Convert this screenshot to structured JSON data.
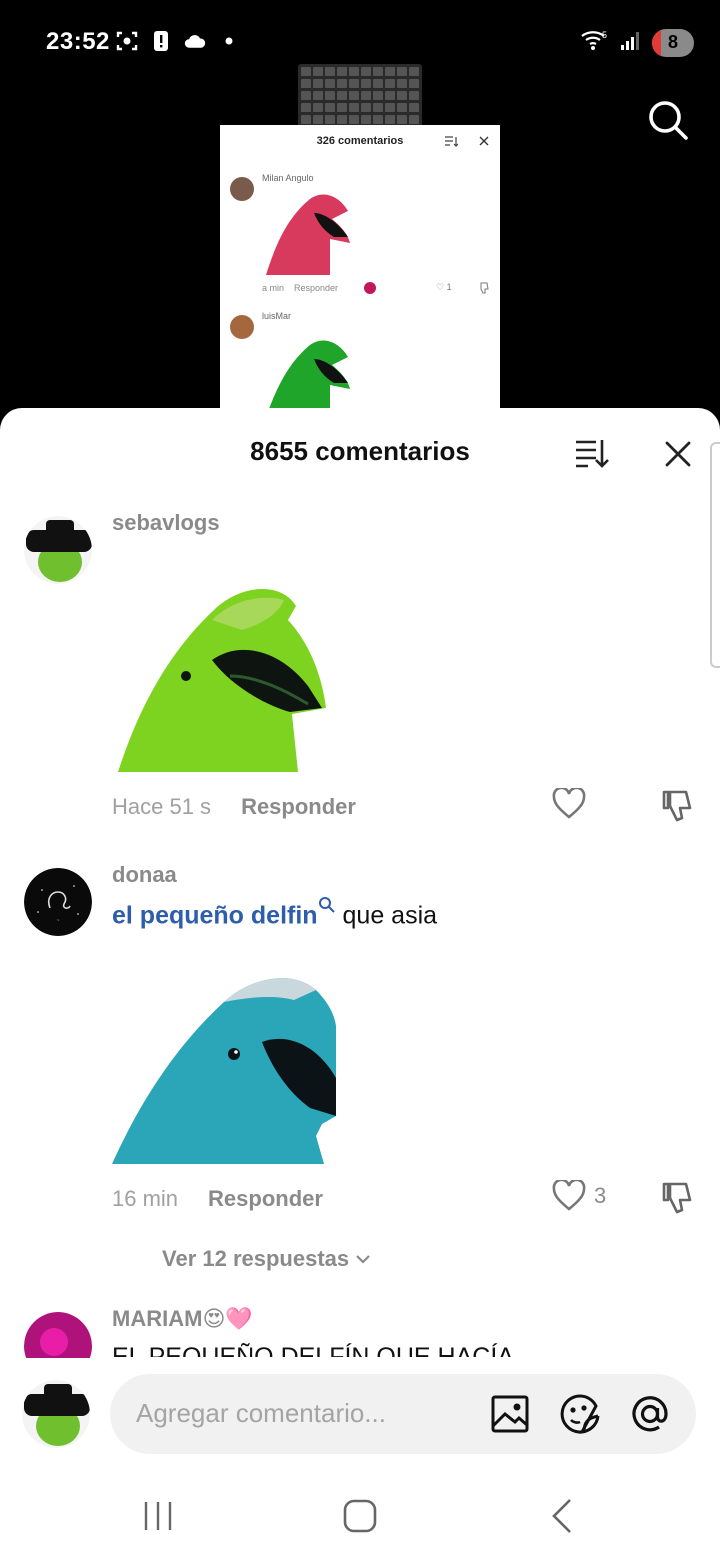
{
  "status_bar": {
    "time": "23:52",
    "battery_level": "8",
    "signal_label": "5"
  },
  "mini_preview": {
    "title": "326 comentarios",
    "comments": [
      {
        "user": "Milan Angulo",
        "time": "a min",
        "reply": "Responder",
        "likes": "1"
      },
      {
        "user": "luisMar"
      }
    ]
  },
  "sheet": {
    "title": "8655 comentarios"
  },
  "comments": [
    {
      "username": "sebavlogs",
      "time": "Hace 51 s",
      "reply_label": "Responder",
      "likes": ""
    },
    {
      "username": "donaa",
      "hashtag": "el pequeño delfin",
      "text": " que asia",
      "time": "16 min",
      "reply_label": "Responder",
      "likes": "3",
      "view_replies": "Ver 12 respuestas"
    },
    {
      "username": "MARIAM",
      "username_emoji": "😍🩷",
      "text": "EL PEQUEÑO DELFÍN QUE HACÍA"
    }
  ],
  "composer": {
    "placeholder": "Agregar comentario..."
  },
  "colors": {
    "hashtag": "#2e5dab",
    "muted": "#8a8a8a",
    "sheet_bg": "#ffffff",
    "backdrop": "#000000"
  }
}
